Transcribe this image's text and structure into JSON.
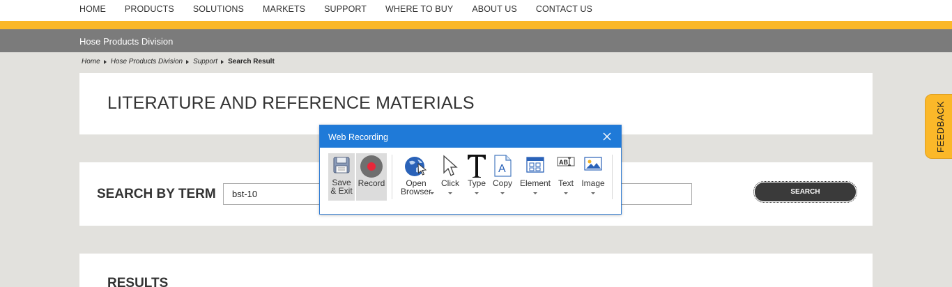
{
  "topnav": {
    "items": [
      "HOME",
      "PRODUCTS",
      "SOLUTIONS",
      "MARKETS",
      "SUPPORT",
      "WHERE TO BUY",
      "ABOUT US",
      "CONTACT US"
    ]
  },
  "division": {
    "title": "Hose Products Division"
  },
  "breadcrumb": {
    "items": [
      "Home",
      "Hose Products Division",
      "Support"
    ],
    "current": "Search Result"
  },
  "page": {
    "title": "LITERATURE AND REFERENCE MATERIALS"
  },
  "search": {
    "heading": "SEARCH BY TERM",
    "value": "bst-10",
    "button": "SEARCH"
  },
  "results": {
    "heading": "RESULTS"
  },
  "feedback": {
    "label": "FEEDBACK"
  },
  "dialog": {
    "title": "Web Recording",
    "buttons": {
      "save": "Save\n& Exit",
      "record": "Record",
      "open_browser": "Open\nBrowser",
      "click": "Click",
      "type": "Type",
      "copy": "Copy",
      "element": "Element",
      "text": "Text",
      "image": "Image"
    }
  },
  "colors": {
    "accent_yellow": "#fbb829",
    "division_gray": "#7b7b7b",
    "dialog_blue": "#1f7ad8",
    "record_red": "#e8283a"
  }
}
